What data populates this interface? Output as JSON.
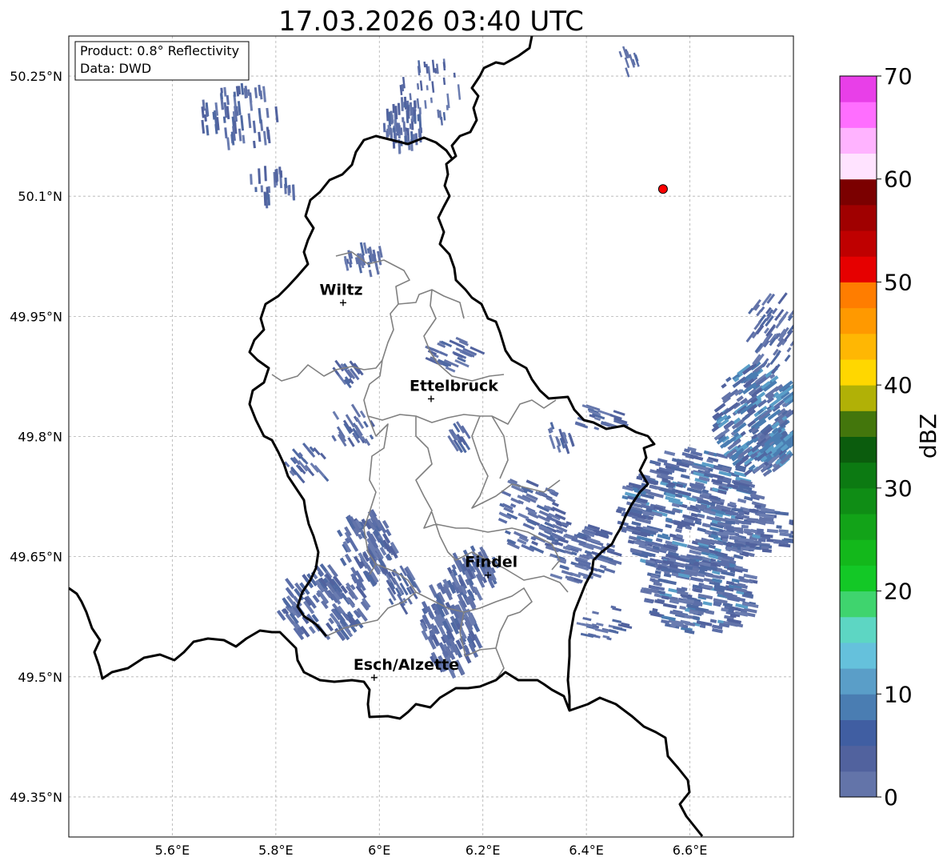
{
  "title": "17.03.2026 03:40 UTC",
  "info_box": {
    "product": "Product: 0.8° Reflectivity",
    "data": "Data: DWD"
  },
  "map": {
    "lon_range": [
      5.4,
      6.8
    ],
    "lat_range": [
      49.3,
      50.3
    ],
    "lat_ticks": [
      {
        "value": 50.25,
        "label": "50.25°N"
      },
      {
        "value": 50.1,
        "label": "50.1°N"
      },
      {
        "value": 49.95,
        "label": "49.95°N"
      },
      {
        "value": 49.8,
        "label": "49.8°N"
      },
      {
        "value": 49.65,
        "label": "49.65°N"
      },
      {
        "value": 49.5,
        "label": "49.5°N"
      },
      {
        "value": 49.35,
        "label": "49.35°N"
      }
    ],
    "lon_ticks": [
      {
        "value": 5.6,
        "label": "5.6°E"
      },
      {
        "value": 5.8,
        "label": "5.8°E"
      },
      {
        "value": 6.0,
        "label": "6°E"
      },
      {
        "value": 6.2,
        "label": "6.2°E"
      },
      {
        "value": 6.4,
        "label": "6.4°E"
      },
      {
        "value": 6.6,
        "label": "6.6°E"
      }
    ],
    "grid": true,
    "cities": [
      {
        "name": "Wiltz",
        "lon": 5.93,
        "lat": 49.967
      },
      {
        "name": "Ettelbruck",
        "lon": 6.1,
        "lat": 49.847
      },
      {
        "name": "Findel",
        "lon": 6.21,
        "lat": 49.627
      },
      {
        "name": "Esch/Alzette",
        "lon": 5.99,
        "lat": 49.499
      }
    ],
    "marker": {
      "lon": 6.548,
      "lat": 50.109,
      "color": "#ff0000"
    }
  },
  "colorbar": {
    "label": "dBZ",
    "min": 0,
    "max": 70,
    "ticks": [
      {
        "value": 0,
        "label": "0"
      },
      {
        "value": 10,
        "label": "10"
      },
      {
        "value": 20,
        "label": "20"
      },
      {
        "value": 30,
        "label": "30"
      },
      {
        "value": 40,
        "label": "40"
      },
      {
        "value": 50,
        "label": "50"
      },
      {
        "value": 60,
        "label": "60"
      },
      {
        "value": 70,
        "label": "70"
      }
    ],
    "colors": [
      "#6374a9",
      "#51629e",
      "#405ea2",
      "#4a7db2",
      "#5a9ec8",
      "#65c1dc",
      "#5dd6c3",
      "#3fd46e",
      "#13c826",
      "#13b81b",
      "#12a318",
      "#0f8d15",
      "#0c7a12",
      "#0b5c0d",
      "#43760c",
      "#b1b106",
      "#ffd700",
      "#ffb703",
      "#ff9900",
      "#ff7d00",
      "#e60000",
      "#bf0000",
      "#a00000",
      "#7b0000",
      "#ffe3ff",
      "#ffb3ff",
      "#ff6eff",
      "#e83fe8"
    ]
  }
}
